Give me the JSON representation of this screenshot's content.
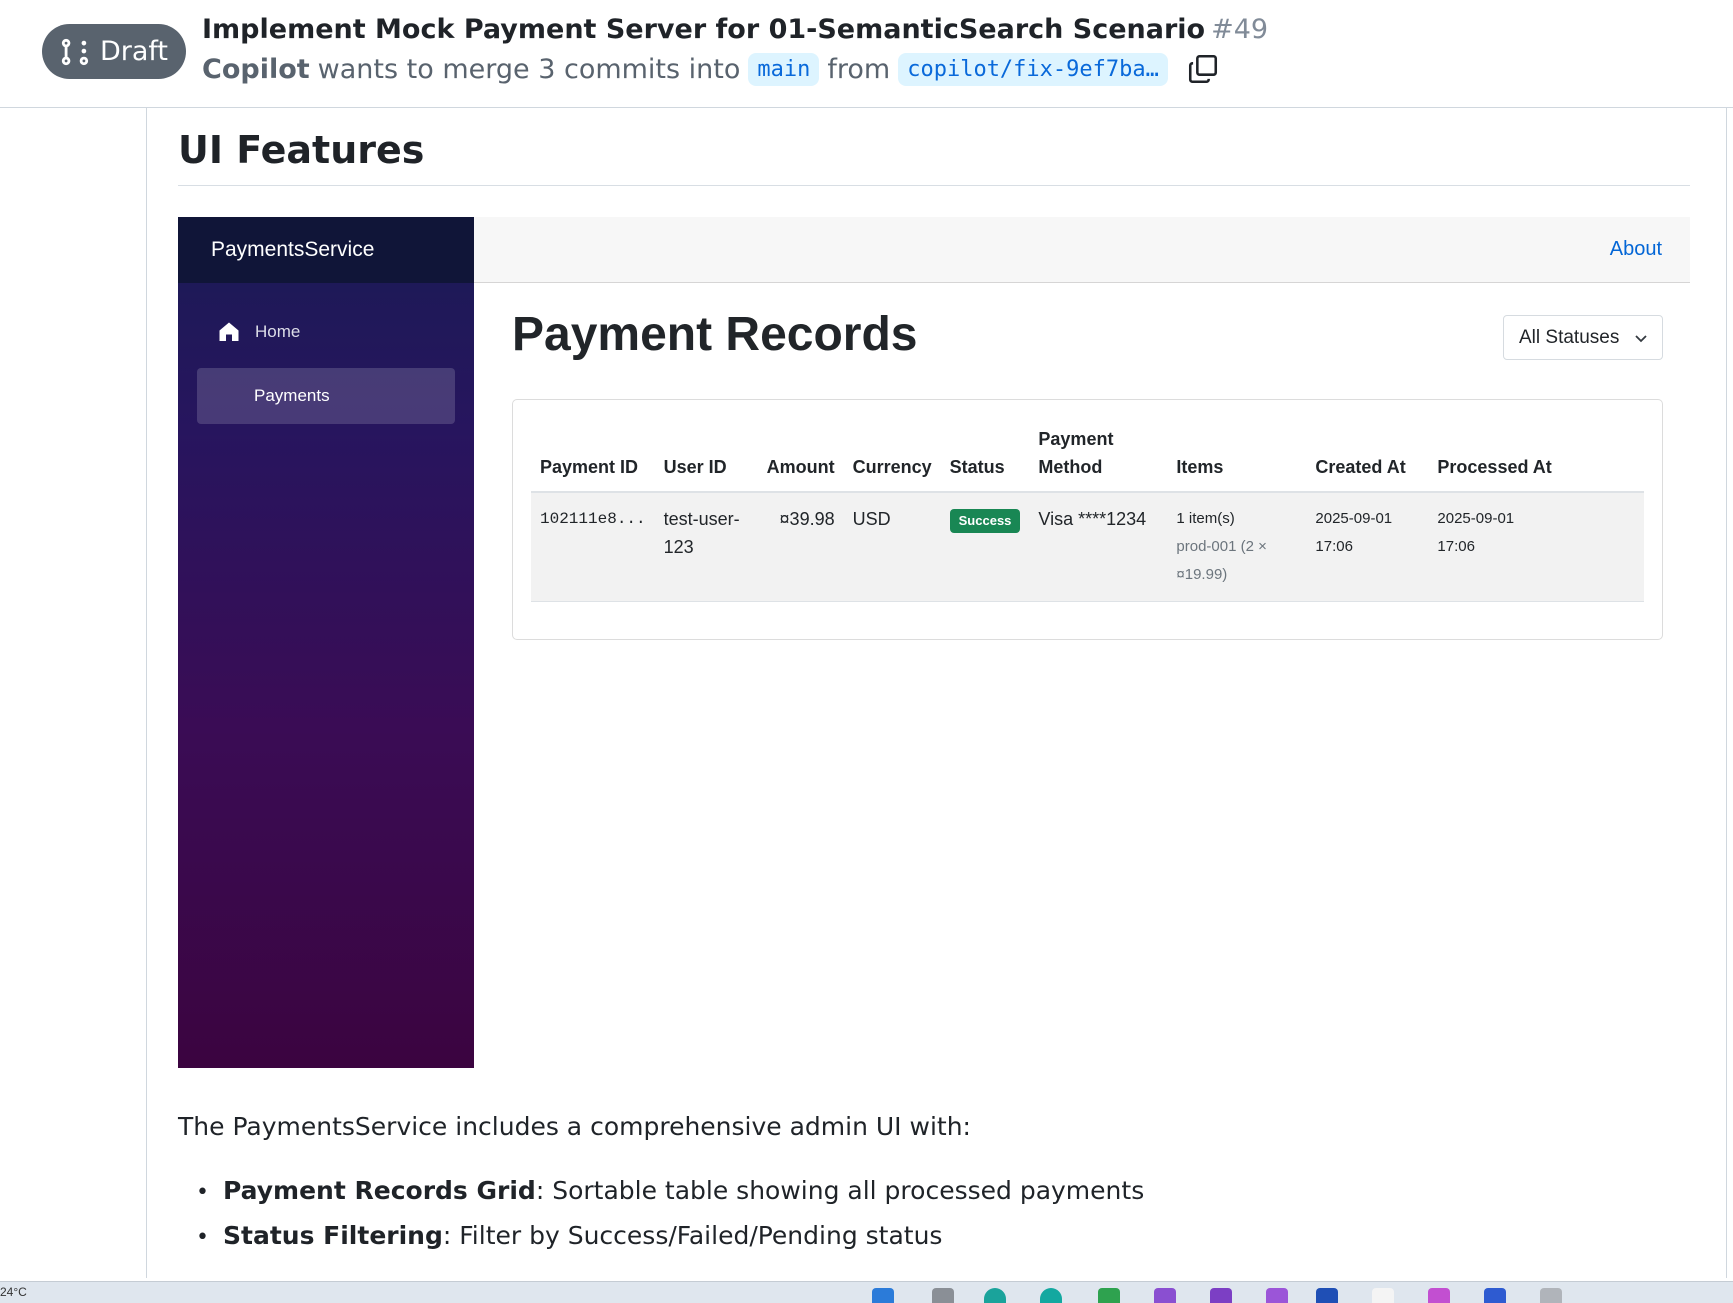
{
  "pr": {
    "draft_label": "Draft",
    "title": "Implement Mock Payment Server for 01-SemanticSearch Scenario",
    "number": "#49",
    "author": "Copilot",
    "merge_text": "wants to merge 3 commits into",
    "base_branch": "main",
    "from_text": "from",
    "head_branch": "copilot/fix-9ef7ba…"
  },
  "section": {
    "heading": "UI Features"
  },
  "app": {
    "brand": "PaymentsService",
    "nav": {
      "home": "Home",
      "payments": "Payments"
    },
    "topbar": {
      "about": "About"
    },
    "page_title": "Payment Records",
    "status_filter": {
      "selected": "All Statuses"
    },
    "table": {
      "headers": {
        "payment_id": "Payment ID",
        "user_id": "User ID",
        "amount": "Amount",
        "currency": "Currency",
        "status": "Status",
        "payment_method_1": "Payment",
        "payment_method_2": "Method",
        "items": "Items",
        "created_at": "Created At",
        "processed_at": "Processed At"
      },
      "rows": [
        {
          "payment_id": "102111e8...",
          "user_id_1": "test-user-",
          "user_id_2": "123",
          "amount": "¤39.98",
          "currency": "USD",
          "status": "Success",
          "payment_method": "Visa ****1234",
          "items_count": "1 item(s)",
          "items_detail_1": "prod-001 (2 ×",
          "items_detail_2": "¤19.99)",
          "created_date": "2025-09-01",
          "created_time": "17:06",
          "processed_date": "2025-09-01",
          "processed_time": "17:06"
        }
      ]
    }
  },
  "description": {
    "intro": "The PaymentsService includes a comprehensive admin UI with:",
    "features": [
      {
        "title": "Payment Records Grid",
        "text": ": Sortable table showing all processed payments"
      },
      {
        "title": "Status Filtering",
        "text": ": Filter by Success/Failed/Pending status"
      }
    ]
  },
  "taskbar": {
    "weather": "24°C"
  },
  "colors": {
    "draft_badge": "#59636e",
    "branch_bg": "#ddf4ff",
    "branch_text": "#0969da",
    "sidebar_top": "#1a1b55",
    "sidebar_bottom": "#3b0440",
    "success_badge": "#198754",
    "link": "#0366d6"
  }
}
